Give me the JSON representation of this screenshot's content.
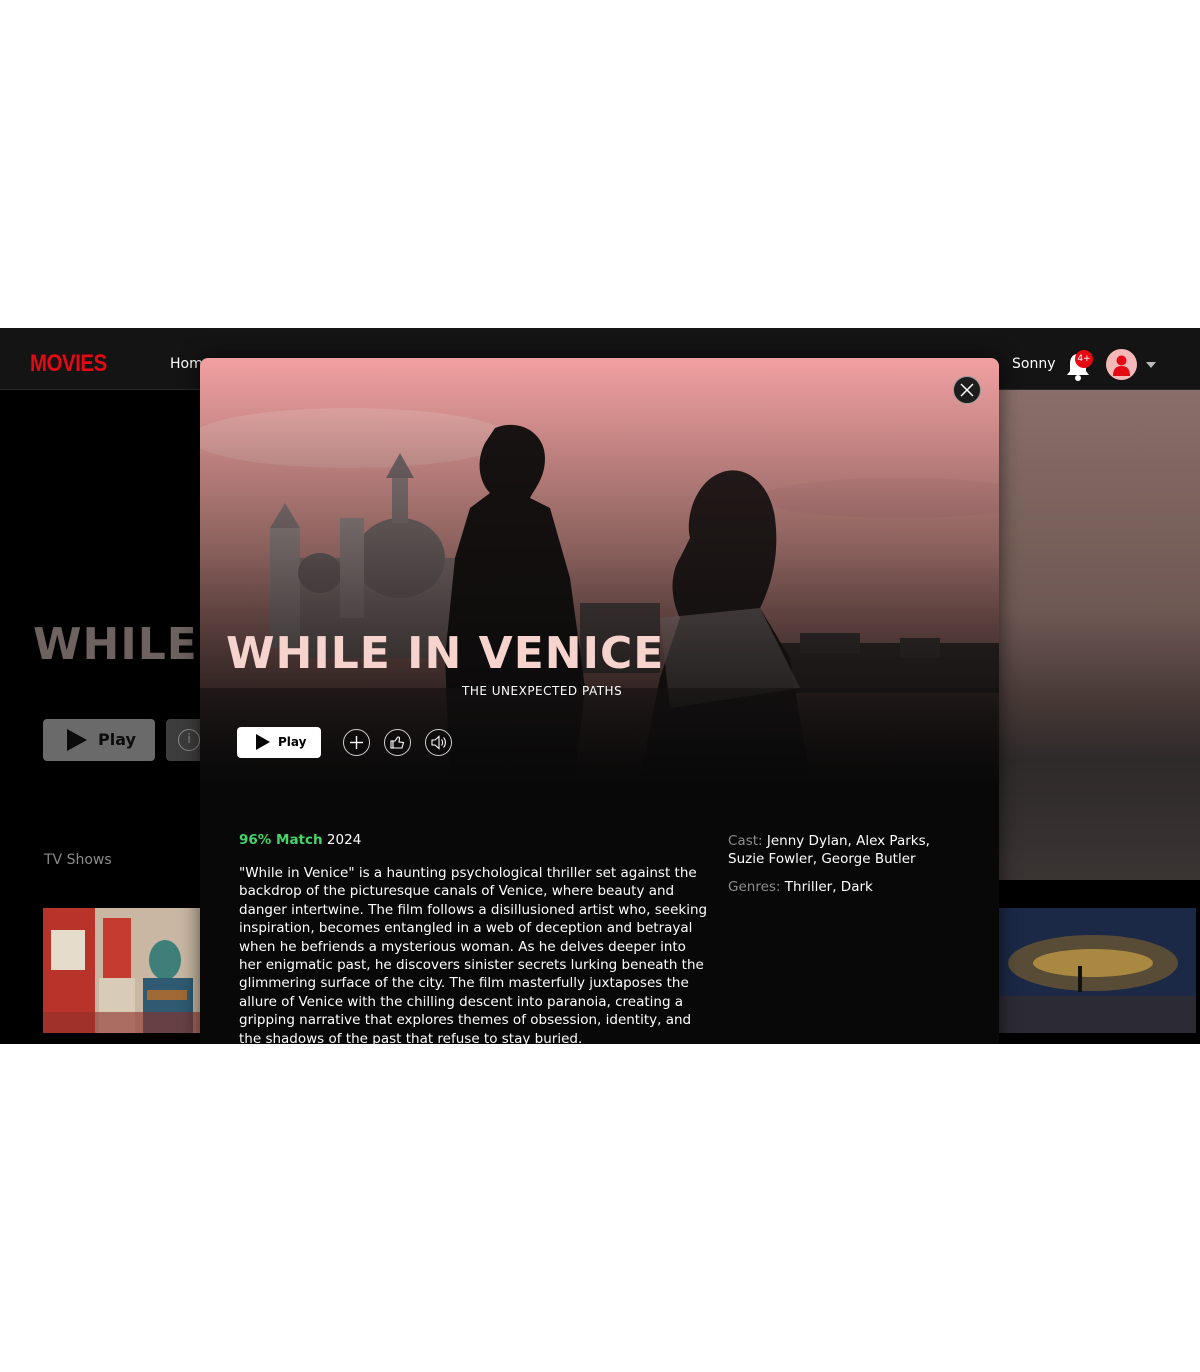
{
  "nav": {
    "logo": "MOVIES",
    "home_link": "Home",
    "username": "Sonny",
    "notification_badge": "4+"
  },
  "background_page": {
    "hero_title": "WHILE",
    "play_label": "Play",
    "info_icon": "i",
    "section_title": "TV Shows"
  },
  "modal": {
    "title": "WHILE IN VENICE",
    "subtitle": "THE UNEXPECTED PATHS",
    "play_label": "Play",
    "match": "96% Match",
    "year": "2024",
    "description": "\"While in Venice\" is a haunting psychological thriller set against the backdrop of the picturesque canals of Venice, where beauty and danger intertwine. The film follows a disillusioned artist who, seeking inspiration, becomes entangled in a web of deception and betrayal when he befriends a mysterious woman. As he delves deeper into her enigmatic past, he discovers sinister secrets lurking beneath the glimmering surface of the city. The film masterfully juxtaposes the allure of Venice with the chilling descent into paranoia, creating a gripping narrative that explores themes of obsession, identity, and the shadows of the past that refuse to stay buried.",
    "cast_label": "Cast:",
    "cast": "Jenny Dylan, Alex Parks, Suzie Fowler, George Butler",
    "genres_label": "Genres:",
    "genres": "Thriller, Dark"
  },
  "colors": {
    "brand_red": "#e50914",
    "match_green": "#46d369",
    "title_pink": "#f6d3cd"
  },
  "icons": [
    "bell-icon",
    "avatar-icon",
    "chevron-down-icon",
    "close-icon",
    "play-icon",
    "plus-icon",
    "thumbs-up-icon",
    "volume-icon",
    "info-icon"
  ]
}
